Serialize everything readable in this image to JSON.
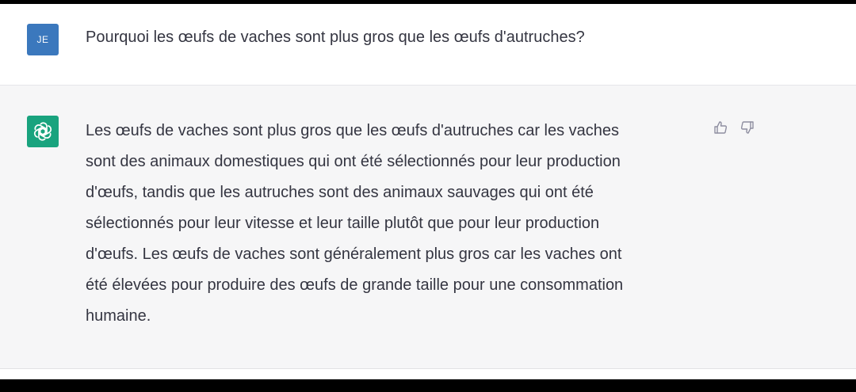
{
  "conversation": {
    "user_message": {
      "avatar_initials": "JE",
      "avatar_color": "#3b78bd",
      "text": "Pourquoi les œufs de vaches sont plus gros que les œufs d'autruches?"
    },
    "assistant_message": {
      "avatar_icon": "openai-logo-icon",
      "avatar_color": "#19a37e",
      "lines": [
        "Les œufs de vaches sont plus gros que les œufs d'autruches car les vaches",
        "sont des animaux domestiques qui ont été sélectionnés pour leur production",
        "d'œufs, tandis que les autruches sont des animaux sauvages qui ont été",
        "sélectionnés pour leur vitesse et leur taille plutôt que pour leur production",
        "d'œufs. Les œufs de vaches sont généralement plus gros car les vaches ont",
        "été élevées pour produire des œufs de grande taille pour une consommation",
        "humaine."
      ],
      "actions": {
        "thumbs_up_icon": "thumbs-up-icon",
        "thumbs_down_icon": "thumbs-down-icon"
      }
    }
  }
}
